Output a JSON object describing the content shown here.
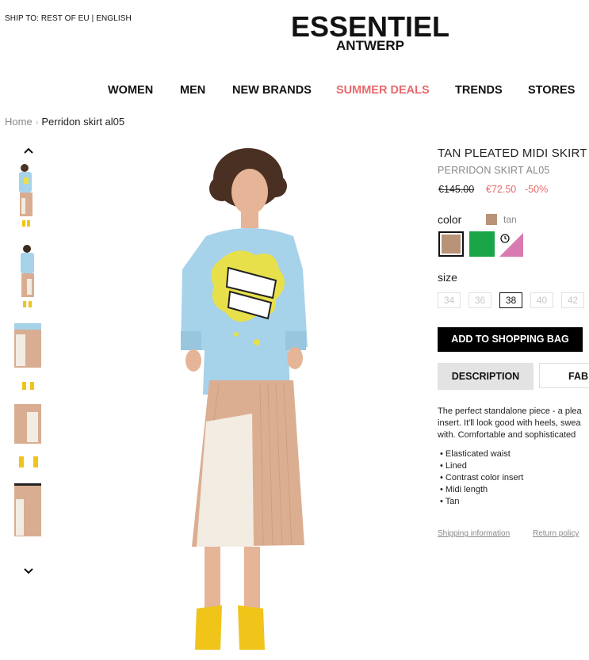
{
  "header": {
    "ship_to": "SHIP TO: REST OF EU | ENGLISH",
    "logo_line1": "ESSENTIEL",
    "logo_line2": "ANTWERP"
  },
  "nav": {
    "items": [
      "WOMEN",
      "MEN",
      "NEW BRANDS",
      "SUMMER DEALS",
      "TRENDS",
      "STORES"
    ],
    "highlight_color": "#e8696c"
  },
  "breadcrumb": {
    "home": "Home",
    "separator": "›",
    "current": "Perridon skirt al05"
  },
  "gallery": {
    "thumbnail_count": 5,
    "up_icon": "chevron-up-icon",
    "down_icon": "chevron-down-icon"
  },
  "product": {
    "title": "TAN PLEATED MIDI SKIRT",
    "subtitle": "PERRIDON SKIRT AL05",
    "price_old": "€145.00",
    "price_new": "€72.50",
    "discount": "-50%",
    "color_label": "color",
    "color_name": "tan",
    "colors": [
      "#b89378",
      "#1aa548",
      "#d97ab0"
    ],
    "size_label": "size",
    "sizes": [
      "34",
      "36",
      "38",
      "40",
      "42"
    ],
    "selected_size": "38",
    "add_to_bag": "ADD TO SHOPPING BAG",
    "tabs": [
      "DESCRIPTION",
      "FAB"
    ],
    "description_lines": [
      "The perfect standalone piece - a plea",
      "insert. It'll look good with heels, swea",
      "with. Comfortable and sophisticated"
    ],
    "features": [
      "Elasticated waist",
      "Lined",
      "Contrast color insert",
      "Midi length",
      "Tan"
    ],
    "links": [
      "Shipping information",
      "Return policy"
    ]
  }
}
